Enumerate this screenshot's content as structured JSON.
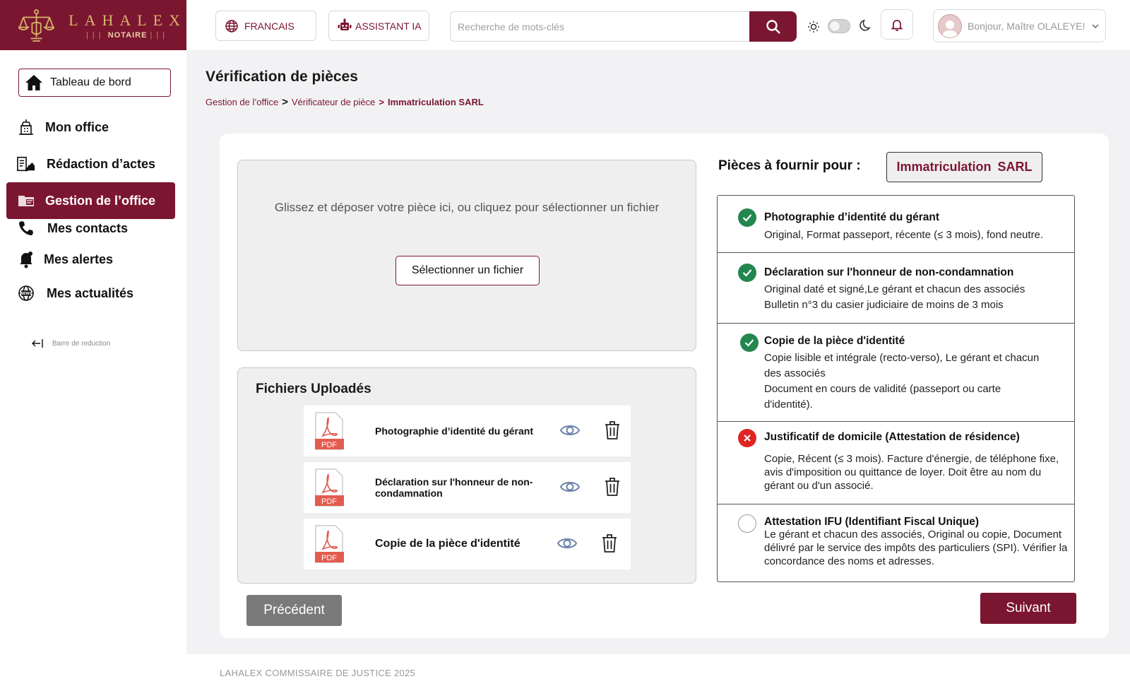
{
  "brand": {
    "name": "LAHALEX",
    "subtitle": "NOTAIRE",
    "color": "#7b1631",
    "gold": "#d9b46a"
  },
  "header": {
    "language_label": "FRANCAIS",
    "ai_assistant_label": "ASSISTANT IA",
    "search_placeholder": "Recherche de mots-clés",
    "theme_toggle_on": false,
    "user_greeting": "Bonjour, Maître OLALEYE!"
  },
  "sidebar": {
    "dashboard_label": "Tableau de bord",
    "items": [
      {
        "label": "Mon office",
        "icon": "office-icon",
        "active": false
      },
      {
        "label": "Rédaction d’actes",
        "icon": "document-writing-icon",
        "active": false
      },
      {
        "label": "Gestion de l’office",
        "icon": "folder-icon",
        "active": true
      },
      {
        "label": "Mes contacts",
        "icon": "phone-icon",
        "active": false
      },
      {
        "label": "Mes alertes",
        "icon": "bell-icon",
        "active": false
      },
      {
        "label": "Mes actualités",
        "icon": "news-icon",
        "active": false
      }
    ],
    "collapse_label": "Barre de reduction"
  },
  "page": {
    "title": "Vérification de pièces",
    "breadcrumb": [
      "Gestion de l’office",
      "Vérificateur de pièce",
      "Immatriculation SARL"
    ]
  },
  "dropzone": {
    "hint": "Glissez et déposer votre pièce ici, ou cliquez pour sélectionner  un fichier",
    "select_button": "Sélectionner un fichier"
  },
  "uploads": {
    "title": "Fichiers Uploadés",
    "files": [
      {
        "name": "Photographie d’identité du gérant",
        "type": "PDF"
      },
      {
        "name": "Déclaration sur l'honneur de non-condamnation",
        "type": "PDF"
      },
      {
        "name": "Copie de la pièce d'identité",
        "type": "PDF"
      }
    ]
  },
  "requirements": {
    "title": "Pièces à fournir pour :",
    "procedure": "Immatriculation  SARL",
    "items": [
      {
        "status": "ok",
        "name": "Photographie d’identité du gérant",
        "description": "Original, Format passeport, récente (≤ 3 mois), fond neutre."
      },
      {
        "status": "ok",
        "name": "Déclaration sur l'honneur de non-condamnation",
        "description": "Original daté et signé,Le gérant et chacun des associés\nBulletin n°3 du casier judiciaire de moins de 3 mois"
      },
      {
        "status": "ok",
        "name": "Copie de la pièce d'identité",
        "description": "Copie lisible et intégrale (recto-verso), Le gérant et chacun des associés\nDocument en cours de validité (passeport ou carte d'identité)."
      },
      {
        "status": "ko",
        "name": "Justificatif de domicile (Attestation de résidence)",
        "description": "Copie, Récent (≤ 3 mois). Facture d'énergie, de téléphone fixe, avis d'imposition ou quittance de loyer. Doit être au nom du gérant ou d'un associé."
      },
      {
        "status": "pending",
        "name": "Attestation IFU (Identifiant Fiscal Unique)",
        "description": "Le gérant et chacun des associés, Original ou copie, Document délivré par le service des impôts des particuliers (SPI). Vérifier la concordance des noms et adresses."
      }
    ]
  },
  "actions": {
    "previous": "Précédent",
    "next": "Suivant"
  },
  "footer": {
    "text": "LAHALEX COMMISSAIRE DE JUSTICE 2025"
  }
}
